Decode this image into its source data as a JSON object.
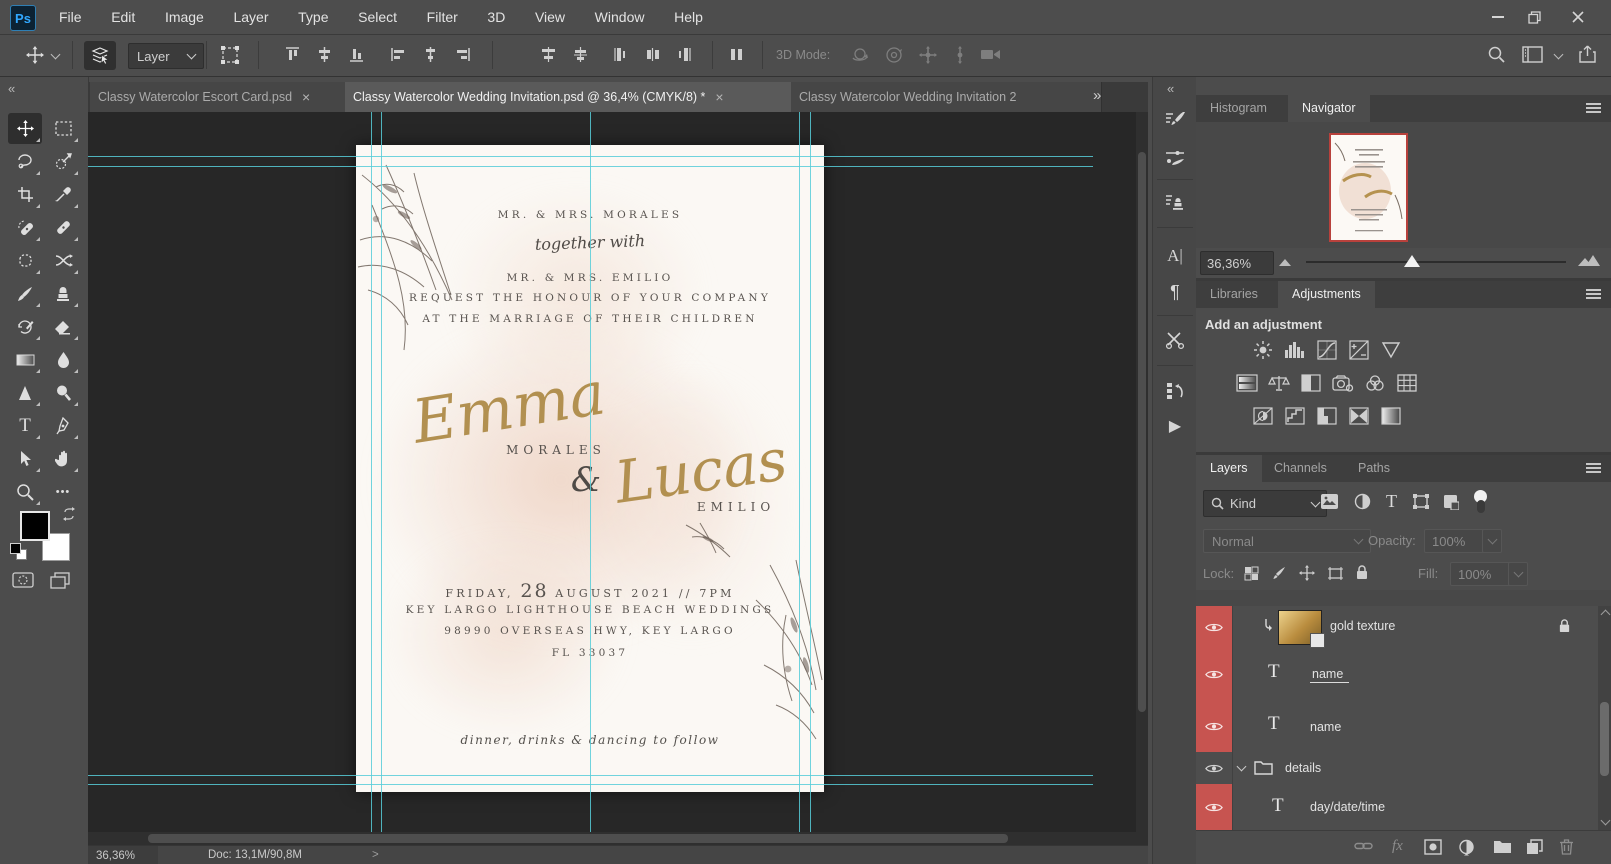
{
  "app": {
    "logo": "Ps"
  },
  "menu": {
    "items": [
      "File",
      "Edit",
      "Image",
      "Layer",
      "Type",
      "Select",
      "Filter",
      "3D",
      "View",
      "Window",
      "Help"
    ]
  },
  "options": {
    "layer_select": "Layer",
    "mode_label": "3D Mode:"
  },
  "tabs": {
    "items": [
      {
        "label": "Classy Watercolor Escort Card.psd"
      },
      {
        "label": "Classy Watercolor Wedding Invitation.psd @ 36,4% (CMYK/8) *"
      },
      {
        "label": "Classy Watercolor Wedding Invitation 2"
      }
    ],
    "close_glyph": "×",
    "overflow_glyph": "»"
  },
  "icons": {
    "character": "A|",
    "paragraph": "¶",
    "play": "▶",
    "collapse": "«",
    "dots": "•••"
  },
  "navigator": {
    "tab_histogram": "Histogram",
    "tab_navigator": "Navigator",
    "zoom": "36,36%"
  },
  "adjustments": {
    "tab_libraries": "Libraries",
    "tab_adjustments": "Adjustments",
    "heading": "Add an adjustment"
  },
  "layers": {
    "tab_layers": "Layers",
    "tab_channels": "Channels",
    "tab_paths": "Paths",
    "kind": "Kind",
    "blend_mode": "Normal",
    "opacity_label": "Opacity:",
    "opacity": "100%",
    "lock_label": "Lock:",
    "fill_label": "Fill:",
    "fill": "100%",
    "type_glyph": "T",
    "fx_glyph": "fx",
    "rows": [
      {
        "name": "gold texture"
      },
      {
        "name": "name"
      },
      {
        "name": "name"
      },
      {
        "name": "details"
      },
      {
        "name": "day/date/time"
      }
    ]
  },
  "status": {
    "zoom": "36,36%",
    "doc": "Doc: 13,1M/90,8M",
    "expander": ">"
  },
  "invitation": {
    "line1": "MR. & MRS. MORALES",
    "script": "together with",
    "line2": "MR. & MRS. EMILIO",
    "line3": "REQUEST THE HONOUR OF YOUR COMPANY",
    "line4": "AT THE MARRIAGE OF THEIR CHILDREN",
    "bride_first": "Emma",
    "bride_last": "MORALES",
    "amp": "&",
    "groom_first": "Lucas",
    "groom_last": "EMILIO",
    "date_pre": "FRIDAY,",
    "date_day": "28",
    "date_post": "AUGUST 2021  //  7PM",
    "venue": "KEY LARGO LIGHTHOUSE BEACH WEDDINGS",
    "address": "98990 OVERSEAS HWY, KEY LARGO",
    "zip": "FL 33037",
    "footer": "dinner, drinks & dancing to follow"
  },
  "colors": {
    "accent_red": "#c75450",
    "gold": "#b29050",
    "guide_cyan": "#57cdd8",
    "ps_blue": "#31a8ff"
  }
}
